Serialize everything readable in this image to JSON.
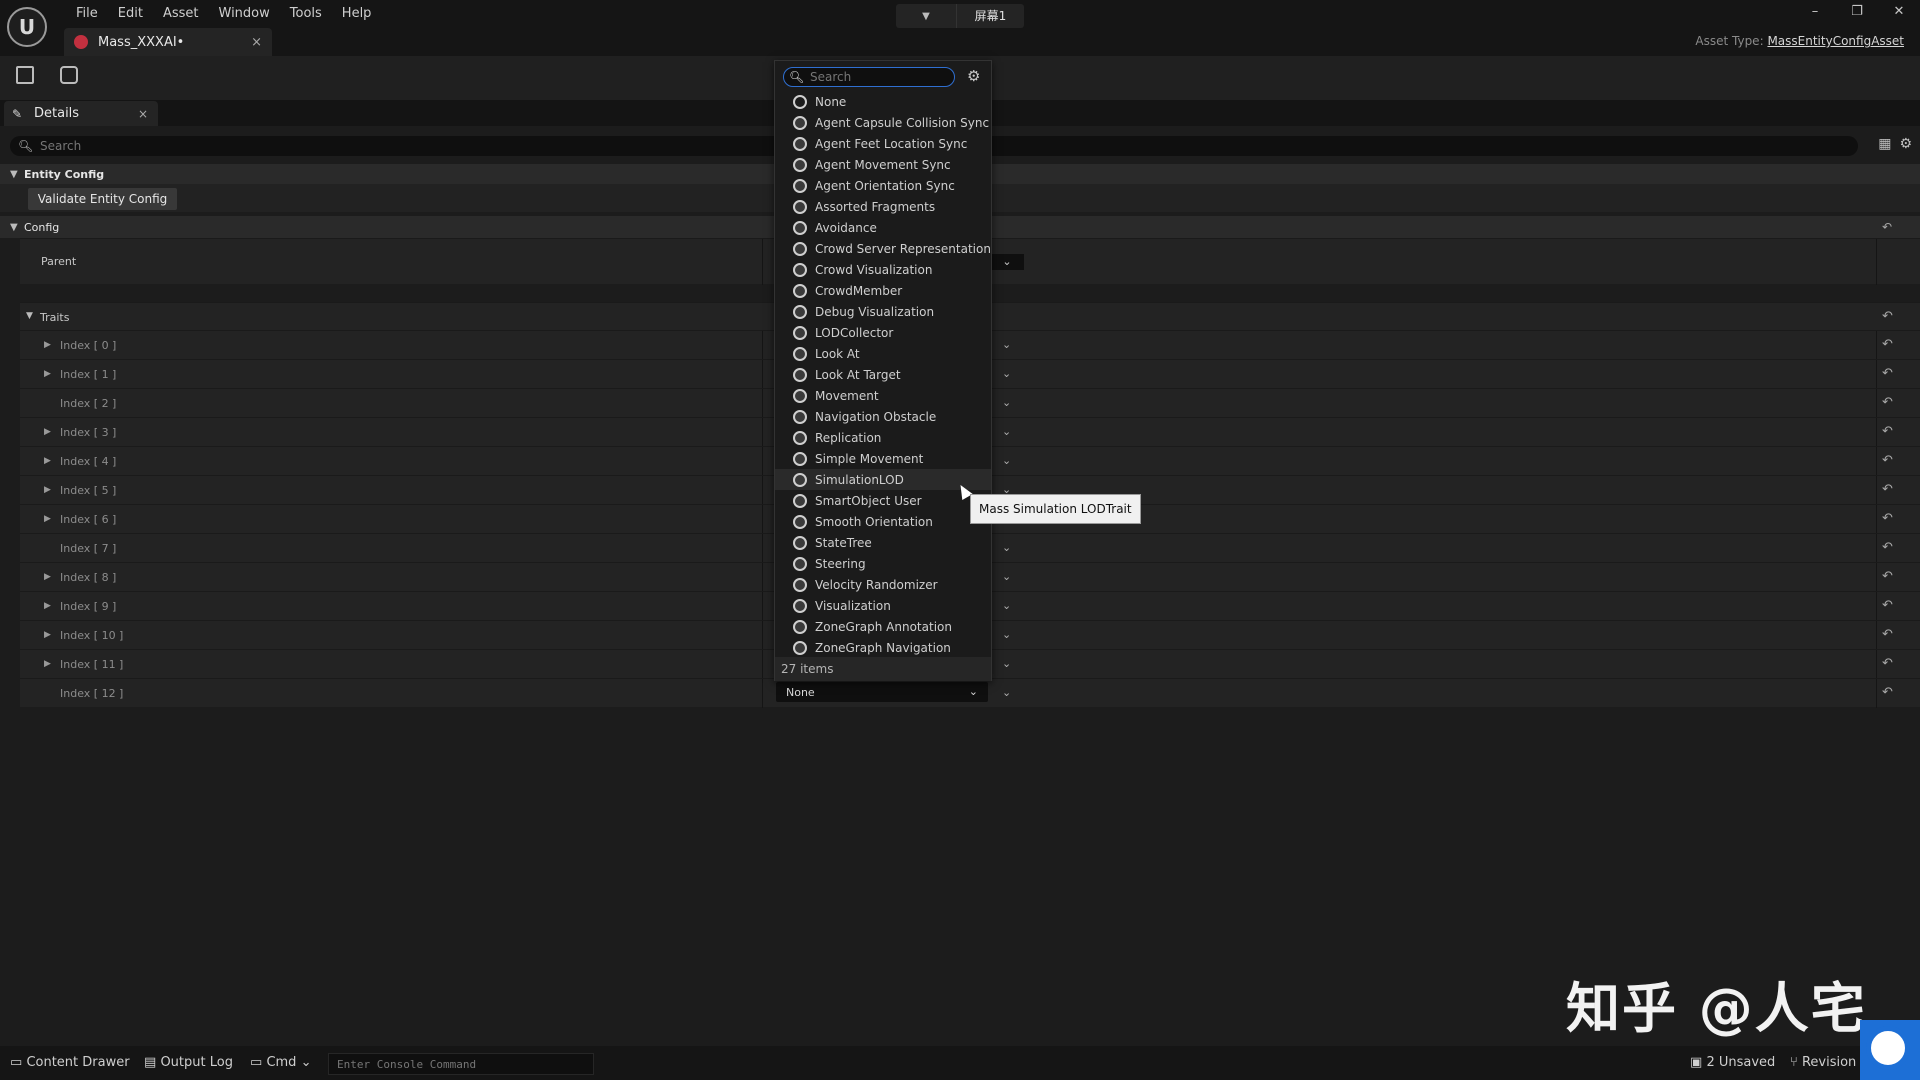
{
  "titlebar": {
    "logo": "U",
    "menu": [
      "File",
      "Edit",
      "Asset",
      "Window",
      "Tools",
      "Help"
    ],
    "asset_tab": {
      "name": "Mass_XXXAI•",
      "close": "×"
    },
    "screen_selector": {
      "label": "屏幕1"
    },
    "window_controls": {
      "minimize": "–",
      "restore": "❐",
      "close": "✕"
    },
    "asset_type_label": "Asset Type:",
    "asset_type_value": "MassEntityConfigAsset"
  },
  "details": {
    "tab_label": "Details",
    "tab_close": "×",
    "search_placeholder": "Search",
    "entity_config_header": "Entity Config",
    "validate_button": "Validate Entity Config",
    "config_header": "Config",
    "parent_label": "Parent",
    "traits_header": "Traits",
    "index_rows": [
      {
        "label": "Index [ 0 ]",
        "expandable": true
      },
      {
        "label": "Index [ 1 ]",
        "expandable": true
      },
      {
        "label": "Index [ 2 ]",
        "expandable": false
      },
      {
        "label": "Index [ 3 ]",
        "expandable": true
      },
      {
        "label": "Index [ 4 ]",
        "expandable": true
      },
      {
        "label": "Index [ 5 ]",
        "expandable": true
      },
      {
        "label": "Index [ 6 ]",
        "expandable": true
      },
      {
        "label": "Index [ 7 ]",
        "expandable": false
      },
      {
        "label": "Index [ 8 ]",
        "expandable": true
      },
      {
        "label": "Index [ 9 ]",
        "expandable": true
      },
      {
        "label": "Index [ 10 ]",
        "expandable": true
      },
      {
        "label": "Index [ 11 ]",
        "expandable": true
      },
      {
        "label": "Index [ 12 ]",
        "expandable": false
      }
    ],
    "index12_value": "None"
  },
  "dropdown": {
    "search_placeholder": "Search",
    "items": [
      "None",
      "Agent Capsule Collision Sync",
      "Agent Feet Location Sync",
      "Agent Movement Sync",
      "Agent Orientation Sync",
      "Assorted Fragments",
      "Avoidance",
      "Crowd Server Representation",
      "Crowd Visualization",
      "CrowdMember",
      "Debug Visualization",
      "LODCollector",
      "Look At",
      "Look At Target",
      "Movement",
      "Navigation Obstacle",
      "Replication",
      "Simple Movement",
      "SimulationLOD",
      "SmartObject User",
      "Smooth Orientation",
      "StateTree",
      "Steering",
      "Velocity Randomizer",
      "Visualization",
      "ZoneGraph Annotation",
      "ZoneGraph Navigation"
    ],
    "hovered_item": "SimulationLOD",
    "footer": "27 items",
    "tooltip": "Mass Simulation LODTrait"
  },
  "watermark": "知乎 @人宅",
  "statusbar": {
    "content_drawer": "Content Drawer",
    "output_log": "Output Log",
    "cmd": "Cmd",
    "console_placeholder": "Enter Console Command",
    "unsaved": "2 Unsaved",
    "revision": "Revision"
  },
  "icons": {
    "search": "search-icon",
    "gear": "gear-icon",
    "save": "save-icon",
    "browse": "browse-icon",
    "reset": "reset-arrow-icon",
    "trait": "trait-class-icon"
  },
  "colors": {
    "accent_blue": "#2f6fd1",
    "asset_dot": "#c2303f"
  }
}
